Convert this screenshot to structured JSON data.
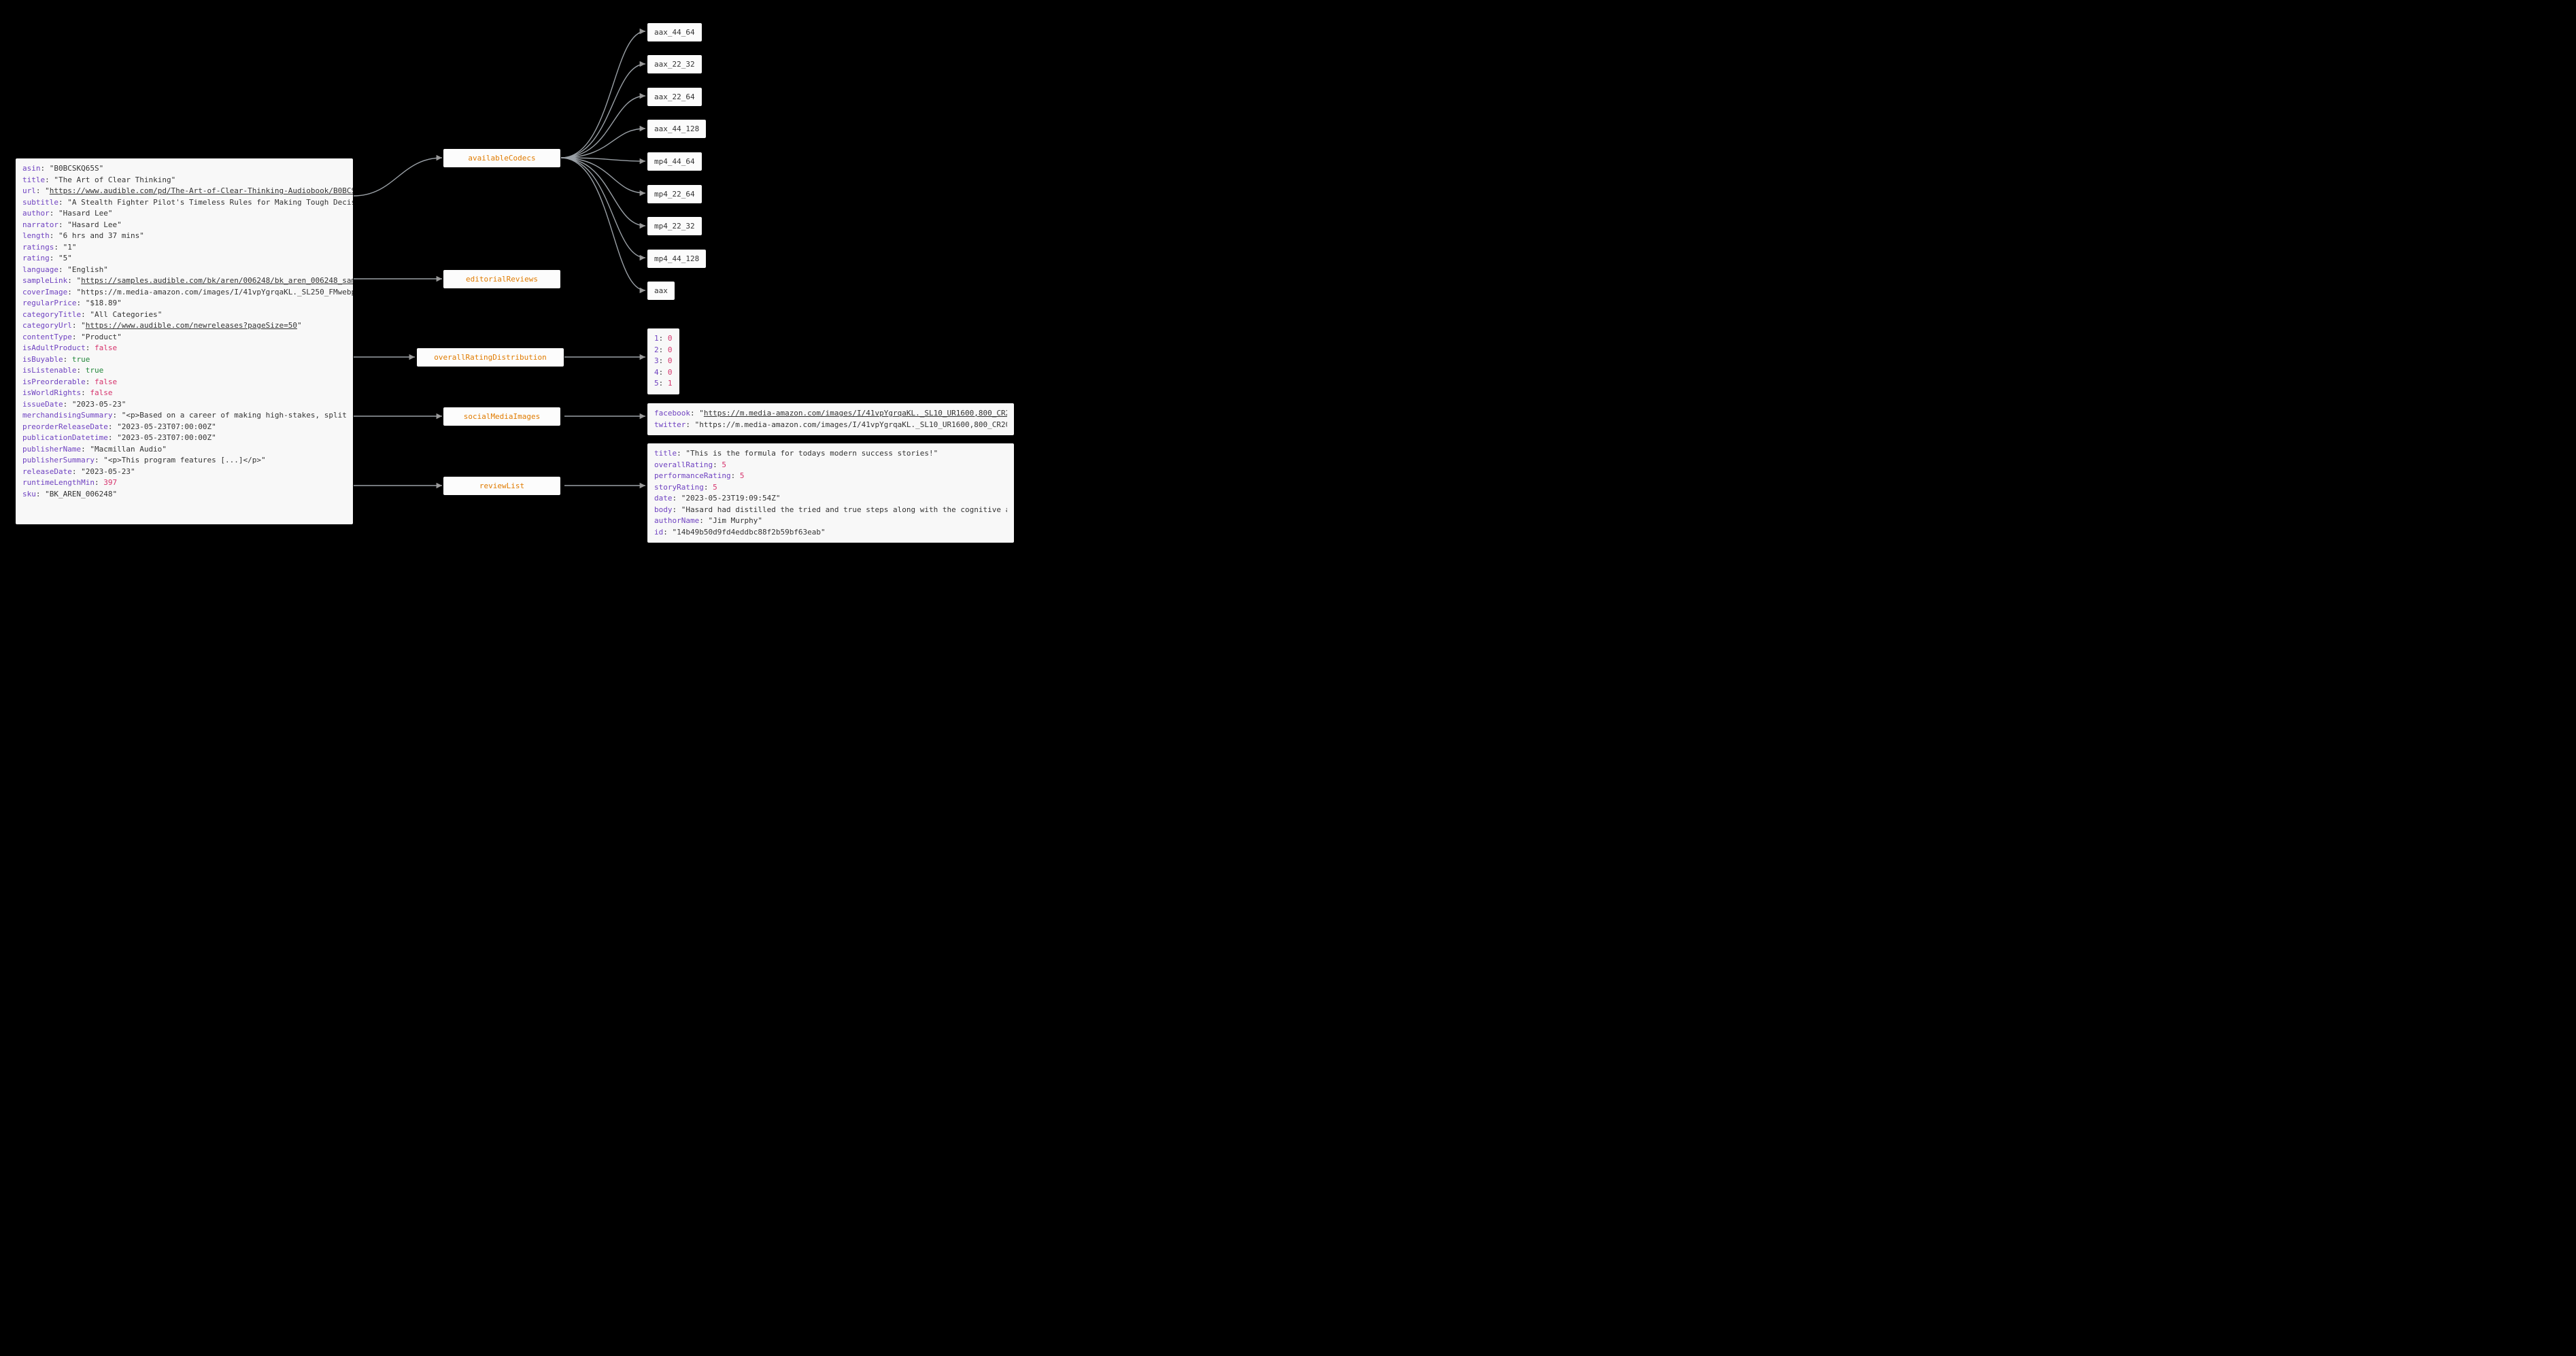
{
  "root": {
    "asin": "B0BCSKQ65S",
    "title": "The Art of Clear Thinking",
    "url": "https://www.audible.com/pd/The-Art-of-Clear-Thinking-Audiobook/B0BCSKQ65S",
    "subtitle": "A Stealth Fighter Pilot's Timeless Rules for Making Tough Decisions",
    "author": "Hasard Lee",
    "narrator": "Hasard Lee",
    "length": "6 hrs and 37 mins",
    "ratings": "1",
    "rating": "5",
    "language": "English",
    "sampleLink": "https://samples.audible.com/bk/aren/006248/bk_aren_006248_sample.mp3",
    "coverImage": "https://m.media-amazon.com/images/I/41vpYgrqaKL._SL250_FMwebp_.jpg",
    "regularPrice": "$18.89",
    "categoryTitle": "All Categories",
    "categoryUrl": "https://www.audible.com/newreleases?pageSize=50",
    "contentType": "Product",
    "isAdultProduct": "false",
    "isBuyable": "true",
    "isListenable": "true",
    "isPreorderable": "false",
    "isWorldRights": "false",
    "issueDate": "2023-05-23",
    "merchandisingSummary": "<p>Based on a career of making high-stakes, split-second de…",
    "preorderReleaseDate": "2023-05-23T07:00:00Z",
    "publicationDatetime": "2023-05-23T07:00:00Z",
    "publisherName": "Macmillan Audio",
    "publisherSummary": "<p>This program features [...]</p>",
    "releaseDate": "2023-05-23",
    "runtimeLengthMin": "397",
    "sku": "BK_AREN_006248"
  },
  "nodes": {
    "availableCodecs": "availableCodecs",
    "editorialReviews": "editorialReviews",
    "overallRatingDistribution": "overallRatingDistribution",
    "socialMediaImages": "socialMediaImages",
    "reviewList": "reviewList"
  },
  "codecs": [
    "aax_44_64",
    "aax_22_32",
    "aax_22_64",
    "aax_44_128",
    "mp4_44_64",
    "mp4_22_64",
    "mp4_22_32",
    "mp4_44_128",
    "aax"
  ],
  "overallRatingDistribution": {
    "1": "0",
    "2": "0",
    "3": "0",
    "4": "0",
    "5": "1"
  },
  "socialMediaImages": {
    "facebook": "https://m.media-amazon.com/images/I/41vpYgrqaKL._SL10_UR1600,800_CR200,50,1200,…",
    "twitter": "https://m.media-amazon.com/images/I/41vpYgrqaKL._SL10_UR1600,800_CR200,50,1024,5…"
  },
  "reviewList": {
    "title": "This is the formula for todays modern success stories!",
    "overallRating": "5",
    "performanceRating": "5",
    "storyRating": "5",
    "date": "2023-05-23T19:09:54Z",
    "body": "Hasard had distilled the tried and true steps along with the cognitive approach…",
    "authorName": "Jim Murphy",
    "id": "14b49b50d9fd4eddbc88f2b59bf63eab"
  }
}
